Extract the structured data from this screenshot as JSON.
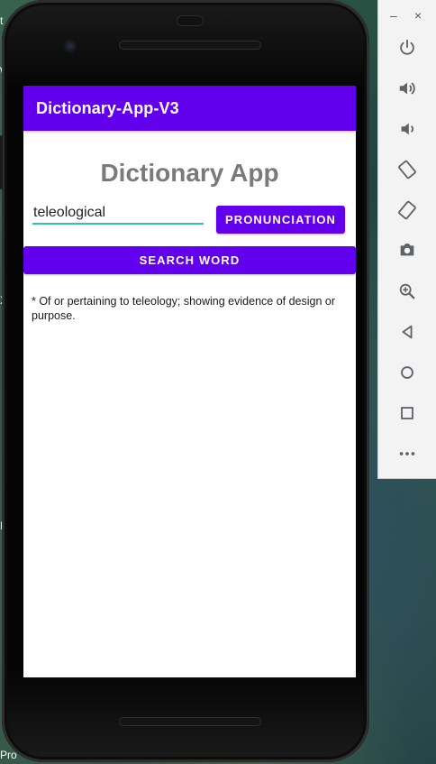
{
  "app": {
    "toolbar_title": "Dictionary-App-V3",
    "heading": "Dictionary App"
  },
  "search": {
    "word_value": "teleological",
    "pronunciation_label": "PRONUNCIATION",
    "search_label": "SEARCH WORD"
  },
  "result": {
    "definition": "* Of or pertaining to teleology; showing evidence of design or purpose."
  },
  "emulator": {
    "minimize_glyph": "–",
    "close_glyph": "×",
    "icons": [
      "power-icon",
      "volume-up-icon",
      "volume-down-icon",
      "rotate-left-icon",
      "rotate-right-icon",
      "camera-icon",
      "zoom-icon",
      "back-icon",
      "home-icon",
      "overview-icon",
      "more-icon"
    ]
  },
  "desktop": {
    "fragments": [
      "t",
      "W",
      "E",
      "X",
      "M",
      "Pro"
    ]
  },
  "colors": {
    "app_bar": "#6200ee",
    "button": "#6200ee",
    "input_underline": "#27c3c3",
    "heading_text": "#7a7a7a",
    "toolbar_icon": "#5f6368"
  }
}
